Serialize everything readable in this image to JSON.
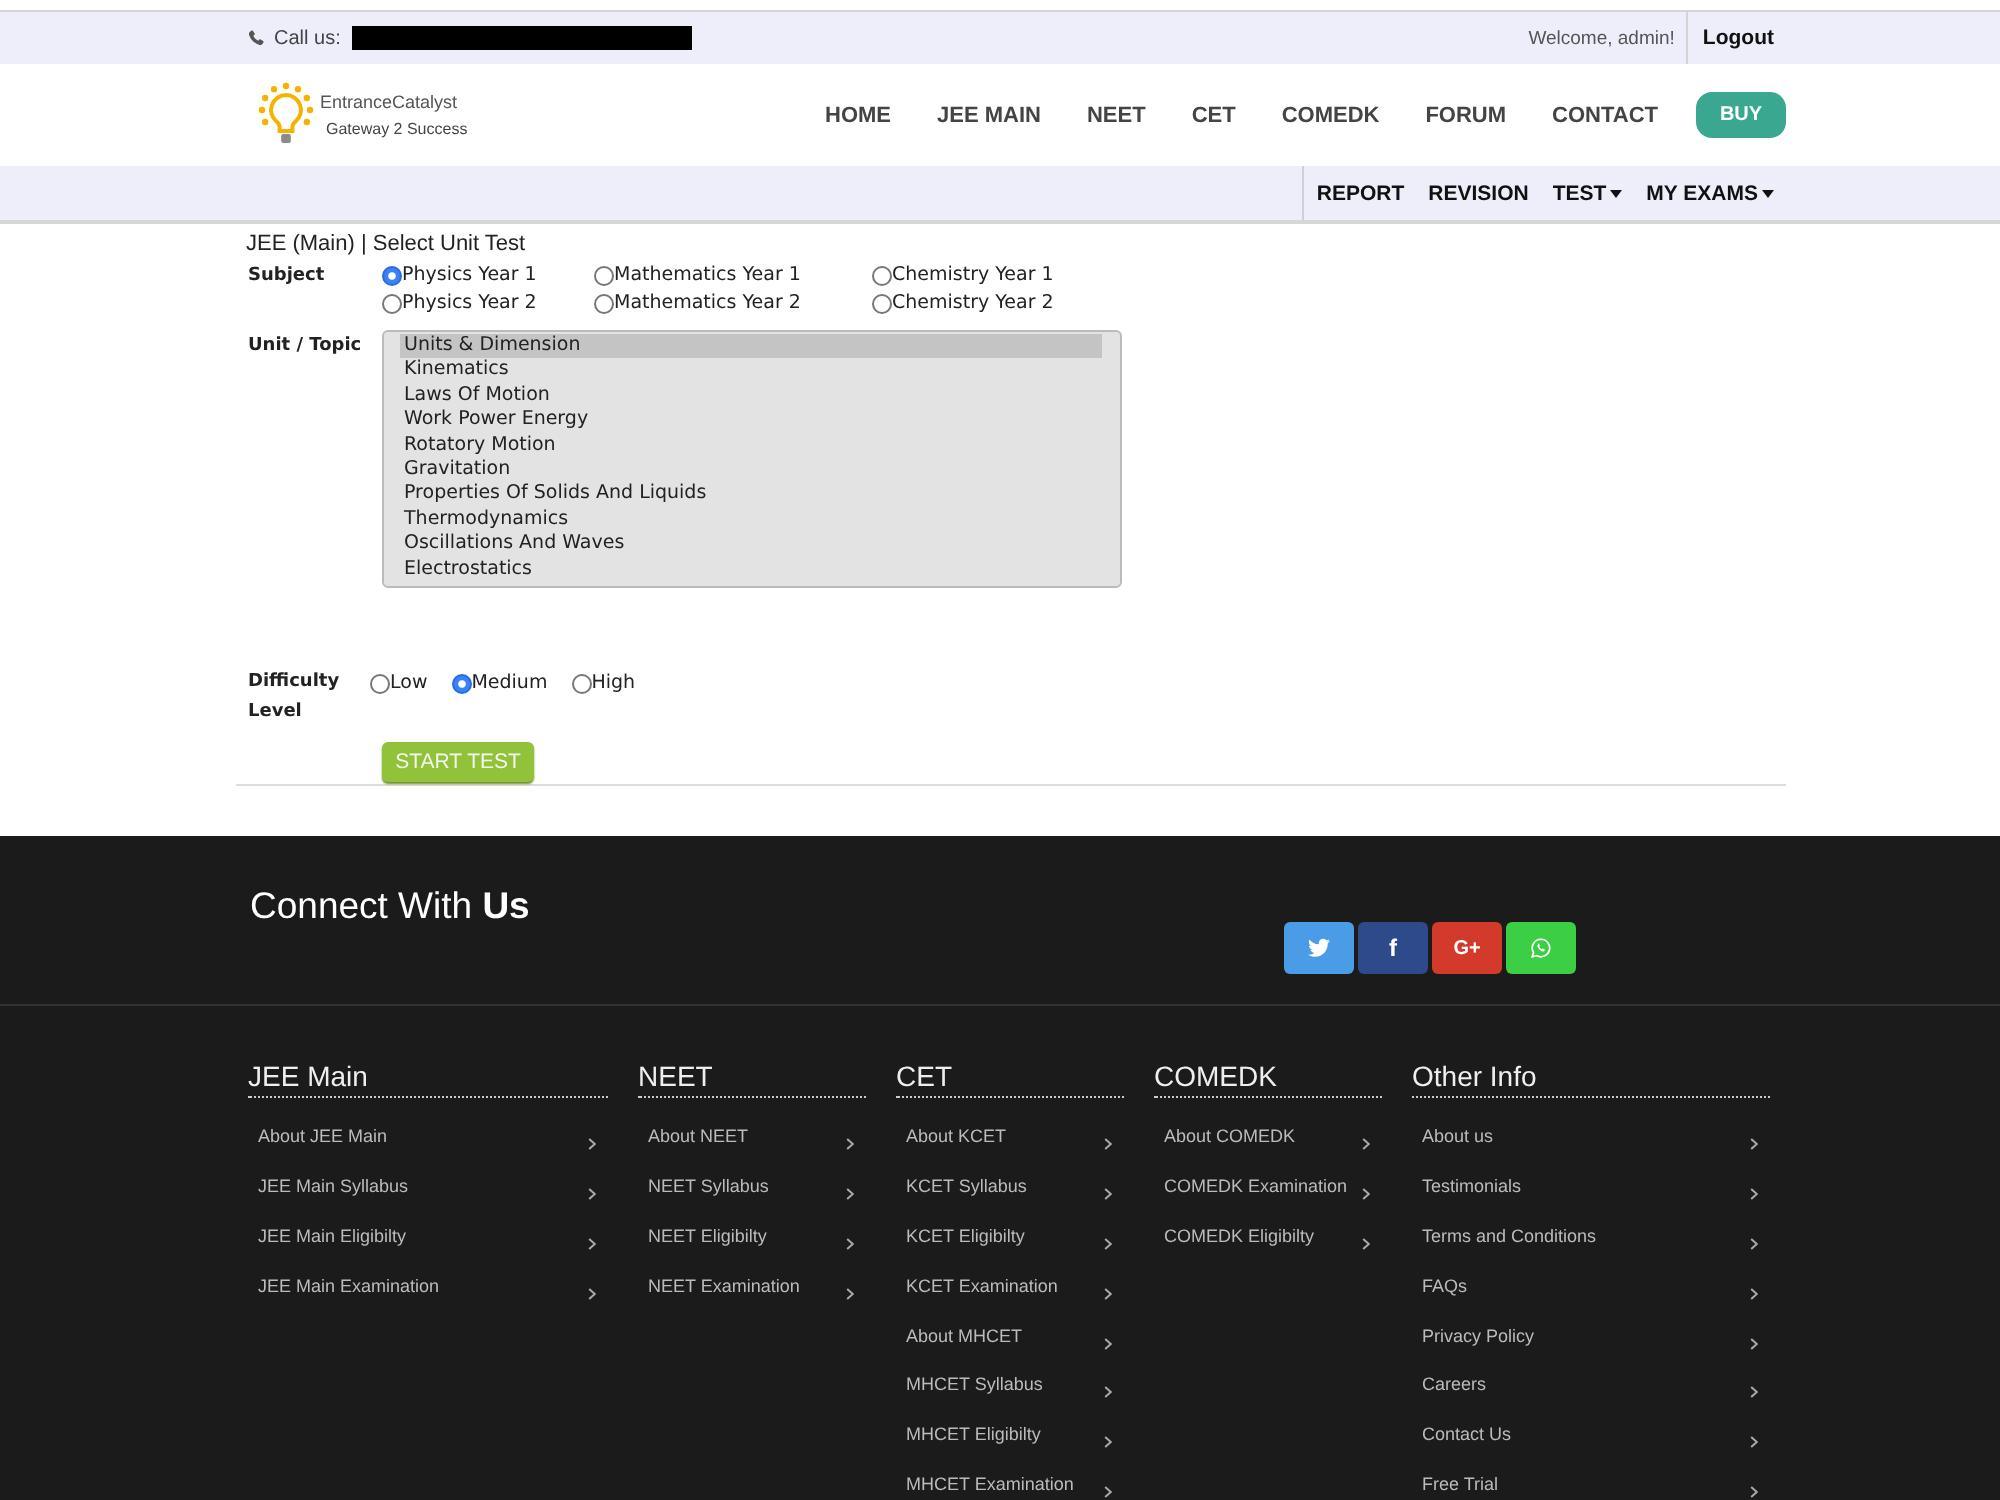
{
  "top_bar": {
    "call_label": "Call us:",
    "welcome": "Welcome, admin!",
    "logout": "Logout"
  },
  "header": {
    "logo": {
      "name": "EntranceCatalyst",
      "tagline": "Gateway 2 Success"
    },
    "nav": [
      "HOME",
      "JEE MAIN",
      "NEET",
      "CET",
      "COMEDK",
      "FORUM",
      "CONTACT"
    ],
    "buy": "BUY"
  },
  "sub_nav": [
    {
      "label": "REPORT",
      "dropdown": false
    },
    {
      "label": "REVISION",
      "dropdown": false
    },
    {
      "label": "TEST",
      "dropdown": true
    },
    {
      "label": "MY EXAMS",
      "dropdown": true
    }
  ],
  "form": {
    "breadcrumb": "JEE (Main) | Select Unit Test",
    "subject": {
      "label": "Subject",
      "options": [
        {
          "label": "Physics Year 1",
          "selected": true
        },
        {
          "label": "Mathematics Year 1",
          "selected": false
        },
        {
          "label": "Chemistry Year 1",
          "selected": false
        },
        {
          "label": "Physics Year 2",
          "selected": false
        },
        {
          "label": "Mathematics Year 2",
          "selected": false
        },
        {
          "label": "Chemistry Year 2",
          "selected": false
        }
      ]
    },
    "unit_topic": {
      "label": "Unit / Topic",
      "options": [
        {
          "label": "Units & Dimension",
          "selected": true
        },
        {
          "label": "Kinematics",
          "selected": false
        },
        {
          "label": "Laws Of Motion",
          "selected": false
        },
        {
          "label": "Work Power Energy",
          "selected": false
        },
        {
          "label": "Rotatory Motion",
          "selected": false
        },
        {
          "label": "Gravitation",
          "selected": false
        },
        {
          "label": "Properties Of Solids And Liquids",
          "selected": false
        },
        {
          "label": "Thermodynamics",
          "selected": false
        },
        {
          "label": "Oscillations And Waves",
          "selected": false
        },
        {
          "label": "Electrostatics",
          "selected": false
        }
      ]
    },
    "difficulty": {
      "label": "Difficulty Level",
      "options": [
        {
          "label": "Low",
          "selected": false
        },
        {
          "label": "Medium",
          "selected": true
        },
        {
          "label": "High",
          "selected": false
        }
      ]
    },
    "submit": "START TEST"
  },
  "footer": {
    "connect_title": "Connect With **Us**",
    "social": [
      {
        "kind": "twitter",
        "color": "#4a9ce6"
      },
      {
        "kind": "facebook",
        "color": "#2e4a8b",
        "label": "f"
      },
      {
        "kind": "google",
        "color": "#d33a2c",
        "label": "G+"
      },
      {
        "kind": "whatsapp",
        "color": "#3ccf45"
      }
    ],
    "columns": [
      {
        "title": "JEE Main",
        "links": [
          "About JEE Main",
          "JEE Main Syllabus",
          "JEE Main Eligibilty",
          "JEE Main Examination"
        ]
      },
      {
        "title": "NEET",
        "links": [
          "About NEET",
          "NEET Syllabus",
          "NEET Eligibilty",
          "NEET Examination"
        ]
      },
      {
        "title": "CET",
        "links": [
          "About KCET",
          "KCET Syllabus",
          "KCET Eligibilty",
          "KCET Examination",
          "About MHCET",
          "MHCET Syllabus",
          "MHCET Eligibilty",
          "MHCET Examination"
        ]
      },
      {
        "title": "COMEDK",
        "links": [
          "About COMEDK",
          "COMEDK Examination",
          "COMEDK Eligibilty"
        ]
      },
      {
        "title": "Other Info",
        "links": [
          "About us",
          "Testimonials",
          "Terms and Conditions",
          "FAQs",
          "Privacy Policy",
          "Careers",
          "Contact Us",
          "Free Trial"
        ]
      }
    ]
  }
}
